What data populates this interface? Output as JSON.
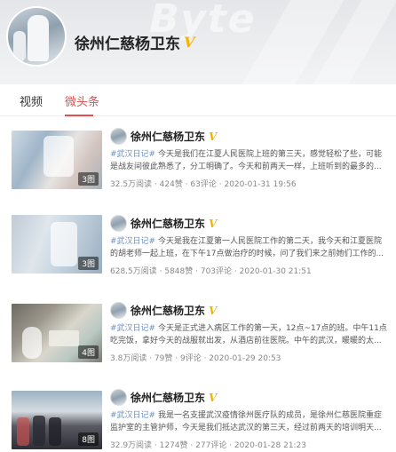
{
  "header": {
    "watermark": "Byte",
    "name": "徐州仁慈杨卫东",
    "verified_badge": "V",
    "verified_color": "#f3b400"
  },
  "tabs": [
    {
      "label": "视频",
      "active": false
    },
    {
      "label": "微头条",
      "active": true
    }
  ],
  "accent_color": "#e84b4b",
  "items": [
    {
      "thumb_count": "3图",
      "author": "徐州仁慈杨卫东",
      "topic": "#武汉日记#",
      "text": " 今天是我们在江夏人民医院上班的第三天，感觉轻松了些，可能是战友间彼此熟悉了，分工明确了。今天和前两天一样，上班听到的最多的...",
      "reads": "32.5万阅读",
      "likes": "424赞",
      "comments": "63评论",
      "time": "2020-01-31 19:56"
    },
    {
      "thumb_count": "3图",
      "author": "徐州仁慈杨卫东",
      "topic": "#武汉日记#",
      "text": " 今天是我在江夏第一人民医院工作的第二天，我今天和江夏医院的胡老师一起上班，在下午17点做治疗的时候，问了我们来之前她们工作的...",
      "reads": "628.5万阅读",
      "likes": "5848赞",
      "comments": "703评论",
      "time": "2020-01-30 21:51"
    },
    {
      "thumb_count": "4图",
      "author": "徐州仁慈杨卫东",
      "topic": "#武汉日记#",
      "text": " 今天是正式进入病区工作的第一天，12点~17点的班。中午11点吃完饭，拿好今天的战服就出发，从酒店前往医院。中午的武汉，暖暖的太...",
      "reads": "3.8万阅读",
      "likes": "79赞",
      "comments": "9评论",
      "time": "2020-01-29 20:53"
    },
    {
      "thumb_count": "8图",
      "author": "徐州仁慈杨卫东",
      "topic": "#武汉日记#",
      "text": " 我是一名支援武汉疫情徐州医疗队的成员，是徐州仁慈医院重症监护室的主管护师，今天是我们抵达武汉的第三天，经过前两天的培训明天...",
      "reads": "32.9万阅读",
      "likes": "1274赞",
      "comments": "277评论",
      "time": "2020-01-28 21:23"
    }
  ]
}
